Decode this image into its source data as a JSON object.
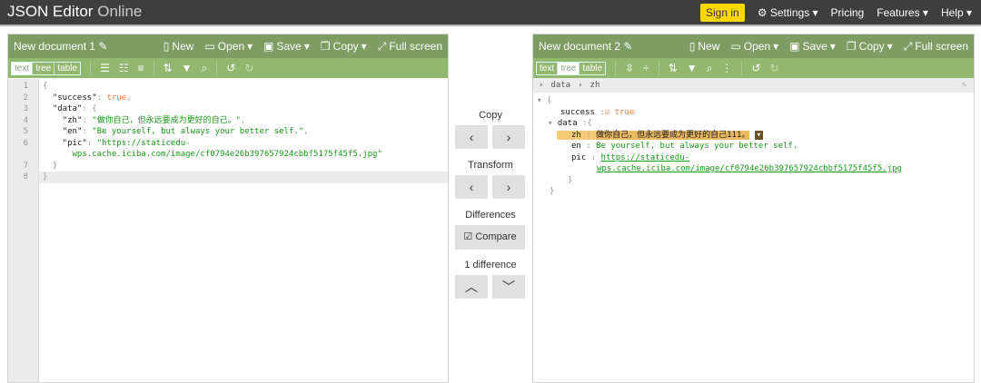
{
  "app": {
    "title": "JSON Editor",
    "title_suffix": "Online"
  },
  "nav": {
    "signin": "Sign in",
    "settings": "Settings",
    "pricing": "Pricing",
    "features": "Features",
    "help": "Help"
  },
  "left": {
    "title": "New document 1",
    "actions": [
      "New",
      "Open",
      "Save",
      "Copy",
      "Full screen"
    ],
    "modes": [
      "text",
      "tree",
      "table"
    ],
    "lines": [
      "1",
      "2",
      "3",
      "4",
      "5",
      "6",
      "",
      "7",
      "8"
    ]
  },
  "right": {
    "title": "New document 2",
    "actions": [
      "New",
      "Open",
      "Save",
      "Copy",
      "Full screen"
    ],
    "modes": [
      "text",
      "tree",
      "table"
    ],
    "breadcrumb": [
      "data",
      "zh"
    ],
    "tree": {
      "success_key": "success",
      "success_val": "true",
      "data_key": "data",
      "zh_key": "zh",
      "zh_val": "做你自己，但永远要成为更好的自己111。",
      "en_key": "en",
      "en_val": "Be yourself, but always your better self.",
      "pic_key": "pic",
      "pic_val1": "https://staticedu-",
      "pic_val2": "wps.cache.iciba.com/image/cf0794e26b397657924cbbf5175f45f5.jpg"
    }
  },
  "code": {
    "success": "\"success\"",
    "true": "true",
    "data": "\"data\"",
    "zh": "\"zh\"",
    "zh_val": "\"做你自己，但永远要成为更好的自己。\"",
    "en": "\"en\"",
    "en_val": "\"Be yourself, but always your better self.\"",
    "pic": "\"pic\"",
    "pic_val1": "\"https://staticedu-",
    "pic_val2": "wps.cache.iciba.com/image/cf0794e26b397657924cbbf5175f45f5.jpg\""
  },
  "middle": {
    "copy": "Copy",
    "transform": "Transform",
    "differences": "Differences",
    "compare": "Compare",
    "diff_count": "1 difference"
  }
}
